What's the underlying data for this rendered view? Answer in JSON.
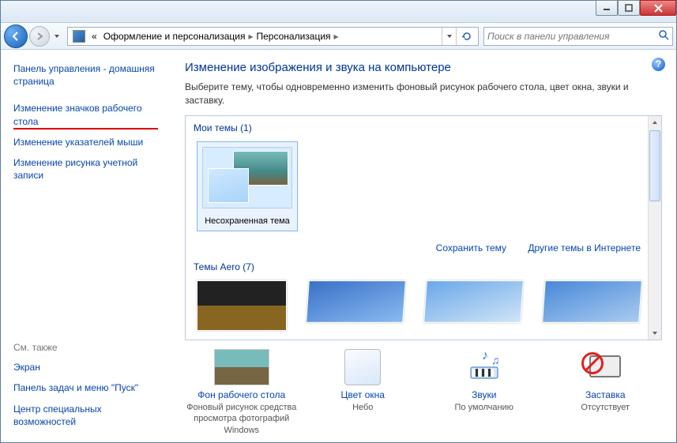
{
  "titlebar": {
    "min": "−",
    "max": "☐",
    "close": "×"
  },
  "nav": {
    "breadcrumb_prefix": "«",
    "crumb1": "Оформление и персонализация",
    "crumb2": "Персонализация"
  },
  "search": {
    "placeholder": "Поиск в панели управления"
  },
  "sidebar": {
    "home": "Панель управления - домашняя страница",
    "link1": "Изменение значков рабочего стола",
    "link2": "Изменение указателей мыши",
    "link3": "Изменение рисунка учетной записи",
    "see_also": "См. также",
    "sa1": "Экран",
    "sa2": "Панель задач и меню \"Пуск\"",
    "sa3": "Центр специальных возможностей"
  },
  "main": {
    "heading": "Изменение изображения и звука на компьютере",
    "sub": "Выберите тему, чтобы одновременно изменить фоновый рисунок рабочего стола, цвет окна, звуки и заставку.",
    "my_themes_hdr": "Мои темы (1)",
    "theme_name": "Несохраненная тема",
    "save_theme": "Сохранить тему",
    "online_themes": "Другие темы в Интернете",
    "aero_hdr": "Темы Aero (7)"
  },
  "settings": {
    "bg": {
      "title": "Фон рабочего стола",
      "desc": "Фоновый рисунок средства просмотра фотографий Windows"
    },
    "color": {
      "title": "Цвет окна",
      "desc": "Небо"
    },
    "sounds": {
      "title": "Звуки",
      "desc": "По умолчанию"
    },
    "saver": {
      "title": "Заставка",
      "desc": "Отсутствует"
    }
  }
}
